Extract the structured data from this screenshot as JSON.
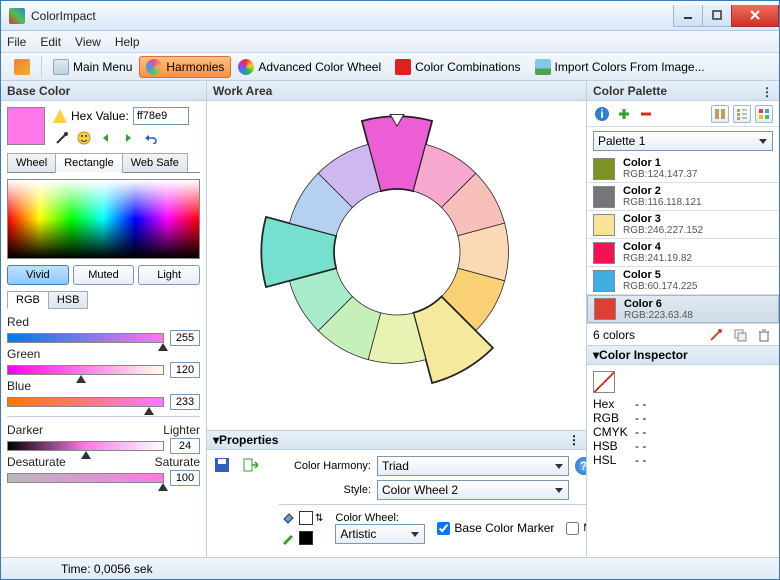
{
  "window": {
    "title": "ColorImpact"
  },
  "menu": {
    "file": "File",
    "edit": "Edit",
    "view": "View",
    "help": "Help"
  },
  "toolbar": {
    "main_menu": "Main Menu",
    "harmonies": "Harmonies",
    "adv_wheel": "Advanced Color Wheel",
    "combos": "Color Combinations",
    "import_img": "Import Colors From Image..."
  },
  "left": {
    "header": "Base Color",
    "hex_label": "Hex Value:",
    "hex_value": "ff78e9",
    "swatch_color": "#ff78e9",
    "tabs": {
      "wheel": "Wheel",
      "rect": "Rectangle",
      "websafe": "Web Safe"
    },
    "variant": {
      "vivid": "Vivid",
      "muted": "Muted",
      "light": "Light"
    },
    "model_tabs": {
      "rgb": "RGB",
      "hsb": "HSB"
    },
    "sliders": {
      "red": {
        "label": "Red",
        "value": "255"
      },
      "green": {
        "label": "Green",
        "value": "120"
      },
      "blue": {
        "label": "Blue",
        "value": "233"
      }
    },
    "dl": {
      "left": "Darker",
      "right": "Lighter",
      "value": "24"
    },
    "ds": {
      "left": "Desaturate",
      "right": "Saturate",
      "value": "100"
    }
  },
  "center": {
    "header": "Work Area",
    "props": {
      "header": "Properties",
      "harmony_label": "Color Harmony:",
      "harmony_value": "Triad",
      "style_label": "Style:",
      "style_value": "Color Wheel 2",
      "wheel_label": "Color Wheel:",
      "wheel_value": "Artistic",
      "base_marker": "Base Color Marker"
    }
  },
  "right": {
    "header": "Color Palette",
    "palette_name": "Palette 1",
    "items": [
      {
        "name": "Color 1",
        "rgb": "RGB:124.147.37",
        "hex": "#7c9325"
      },
      {
        "name": "Color 2",
        "rgb": "RGB:116.118.121",
        "hex": "#747679"
      },
      {
        "name": "Color 3",
        "rgb": "RGB:246.227.152",
        "hex": "#f6e398"
      },
      {
        "name": "Color 4",
        "rgb": "RGB:241.19.82",
        "hex": "#f11352"
      },
      {
        "name": "Color 5",
        "rgb": "RGB:60.174.225",
        "hex": "#3caee1"
      },
      {
        "name": "Color 6",
        "rgb": "RGB:223.63.48",
        "hex": "#df3f30"
      }
    ],
    "count": "6 colors",
    "inspector": {
      "header": "Color Inspector",
      "rows": {
        "hex": {
          "k": "Hex",
          "v": "- -"
        },
        "rgb": {
          "k": "RGB",
          "v": "- -"
        },
        "cmyk": {
          "k": "CMYK",
          "v": "- -"
        },
        "hsb": {
          "k": "HSB",
          "v": "- -"
        },
        "hsl": {
          "k": "HSL",
          "v": "- -"
        }
      }
    }
  },
  "status": {
    "time": "Time: 0,0056 sek"
  },
  "chart_data": {
    "type": "pie",
    "title": "Color Harmony Wheel (Triad)",
    "categories": [
      "magenta",
      "rose",
      "red-pink",
      "peach",
      "orange",
      "yellow",
      "yellow-green",
      "green",
      "teal-green",
      "teal",
      "blue",
      "violet"
    ],
    "colors": [
      "#ec5fd4",
      "#f6a8cf",
      "#f7bfb9",
      "#fbd9b5",
      "#f9d174",
      "#f5e99e",
      "#e8f3b3",
      "#c6efb9",
      "#a8eccb",
      "#75e0cd",
      "#b5d0f0",
      "#cdb9ef"
    ],
    "highlighted_indices": [
      0,
      5,
      9
    ],
    "base_color_index": 0
  }
}
